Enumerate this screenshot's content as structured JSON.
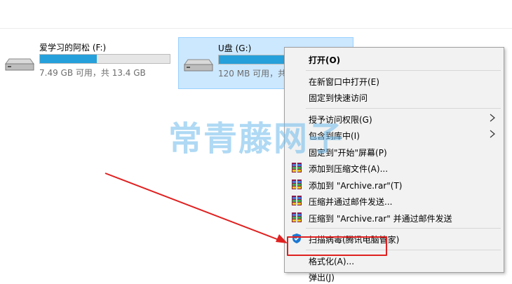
{
  "drives": [
    {
      "name": "爱学习的阿松 (F:)",
      "size_text": "7.49 GB 可用，共 13.4 GB",
      "used_fraction": 0.44,
      "selected": false,
      "icon": "hard-drive-icon"
    },
    {
      "name": "U盘 (G:)",
      "size_text": "120 MB 可用，共",
      "used_fraction": 0.95,
      "selected": true,
      "icon": "usb-drive-icon"
    }
  ],
  "watermark": "常青藤网子",
  "context_menu": {
    "groups": [
      [
        {
          "label": "打开(O)",
          "bold": true
        }
      ],
      [
        {
          "label": "在新窗口中打开(E)"
        },
        {
          "label": "固定到快速访问"
        }
      ],
      [
        {
          "label": "授予访问权限(G)",
          "submenu": true
        },
        {
          "label": "包含到库中(I)",
          "submenu": true
        },
        {
          "label": "固定到\"开始\"屏幕(P)"
        },
        {
          "label": "添加到压缩文件(A)...",
          "icon": "winrar-icon"
        },
        {
          "label": "添加到 \"Archive.rar\"(T)",
          "icon": "winrar-icon"
        },
        {
          "label": "压缩并通过邮件发送...",
          "icon": "winrar-icon"
        },
        {
          "label": "压缩到 \"Archive.rar\" 并通过邮件发送",
          "icon": "winrar-icon"
        }
      ],
      [
        {
          "label": "扫描病毒(腾讯电脑管家)",
          "icon": "shield-icon"
        }
      ],
      [
        {
          "label": "格式化(A)...",
          "highlighted": true
        },
        {
          "label": "弹出(J)"
        }
      ]
    ]
  },
  "colors": {
    "accent": "#26a0da",
    "selection": "#cce8ff",
    "annotation_red": "#e02020"
  }
}
